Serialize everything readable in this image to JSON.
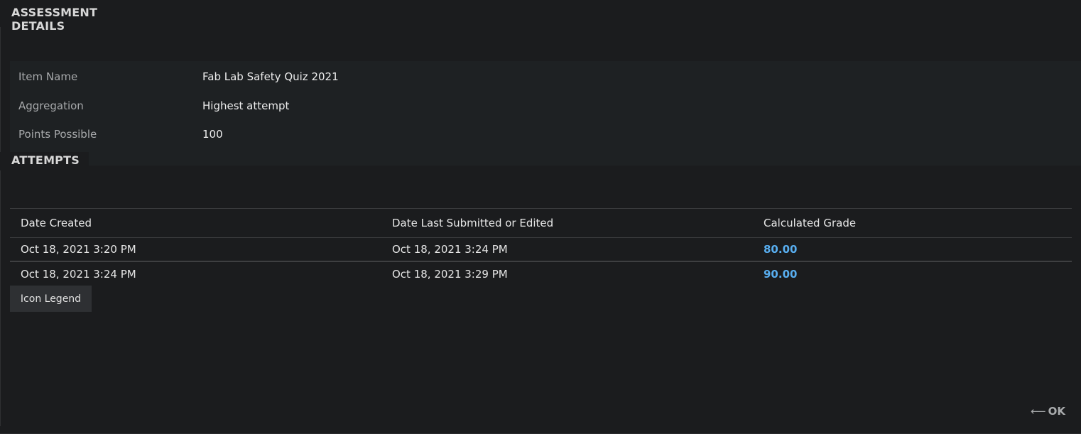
{
  "details": {
    "title": "ASSESSMENT DETAILS",
    "rows": [
      {
        "label": "Item Name",
        "value": "Fab Lab Safety Quiz 2021"
      },
      {
        "label": "Aggregation",
        "value": "Highest attempt"
      },
      {
        "label": "Points Possible",
        "value": "100"
      }
    ]
  },
  "attempts": {
    "title": "ATTEMPTS",
    "columns": [
      "Date Created",
      "Date Last Submitted or Edited",
      "Calculated Grade"
    ],
    "rows": [
      {
        "created": "Oct 18, 2021 3:20 PM",
        "submitted": "Oct 18, 2021 3:24 PM",
        "grade": "80.00"
      },
      {
        "created": "Oct 18, 2021 3:24 PM",
        "submitted": "Oct 18, 2021 3:29 PM",
        "grade": "90.00"
      }
    ]
  },
  "legend_button": "Icon Legend",
  "ok": {
    "arrow_icon": "left-arrow-icon",
    "arrow": "⟵",
    "label": "OK"
  },
  "colors": {
    "background": "#1b1c1e",
    "panel": "#1e2123",
    "link": "#58aef0"
  }
}
